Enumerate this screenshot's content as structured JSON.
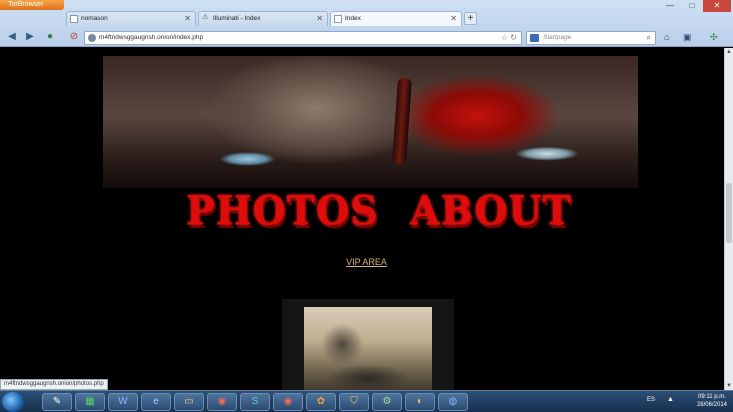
{
  "browser": {
    "menu_label": "TorBrowser",
    "tabs": [
      {
        "label": "nomason",
        "active": false
      },
      {
        "label": "Illuminati - Index",
        "active": false
      },
      {
        "label": "Index",
        "active": true
      }
    ],
    "new_tab_label": "+",
    "url": "m4ftndwsggaugnsh.onion/index.php",
    "search_placeholder": "Startpage"
  },
  "page": {
    "nav_photos": "PHOTOS",
    "nav_about": "ABOUT",
    "vip_link": "VIP AREA"
  },
  "status_bar": {
    "hover_url": "m4ftndwsggaugnsh.onion/photos.php"
  },
  "taskbar": {
    "language": "ES",
    "time": "09:11 p.m.",
    "date": "28/06/2014"
  }
}
